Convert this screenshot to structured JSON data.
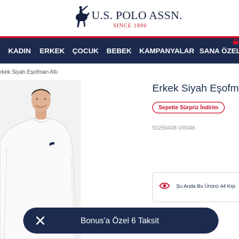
{
  "brand": {
    "name": "U.S. POLO ASSN.",
    "since": "SINCE 1890"
  },
  "nav": {
    "items": [
      {
        "label": "KADIN"
      },
      {
        "label": "ERKEK"
      },
      {
        "label": "ÇOCUK"
      },
      {
        "label": "BEBEK"
      },
      {
        "label": "KAMPANYALAR"
      },
      {
        "label": "SANA ÖZEL"
      }
    ]
  },
  "breadcrumb": "rkek Siyah Eşofman Altı",
  "product": {
    "title": "Erkek Siyah Eşofma",
    "badge": "Sepette Sürpriz İndirim",
    "sku": "50269408-VR046",
    "viewers": "Şu Anda Bu Ürünü 44 Kişi"
  },
  "promo": {
    "label": "Bonus'a Özel 6 Taksit"
  },
  "colors": {
    "navy": "#1b2a4e",
    "red": "#c8102e"
  }
}
